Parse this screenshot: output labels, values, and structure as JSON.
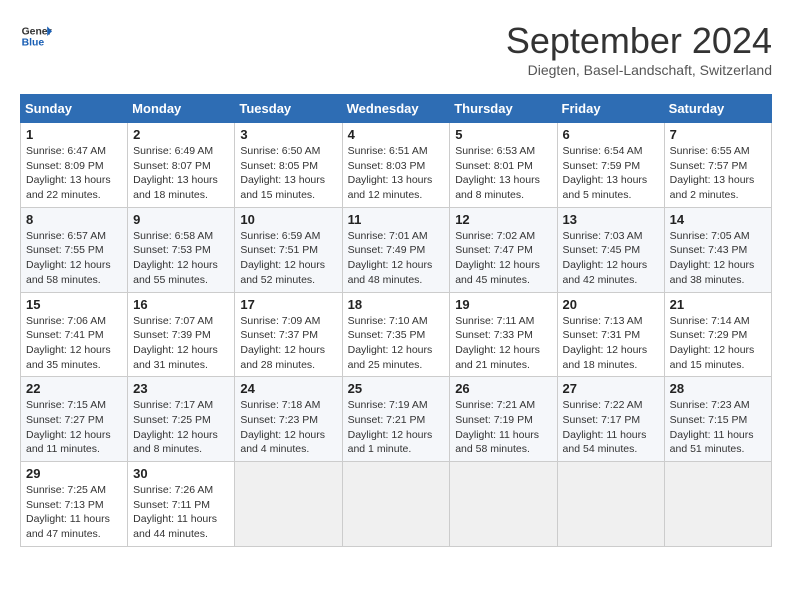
{
  "header": {
    "logo_line1": "General",
    "logo_line2": "Blue",
    "month": "September 2024",
    "location": "Diegten, Basel-Landschaft, Switzerland"
  },
  "weekdays": [
    "Sunday",
    "Monday",
    "Tuesday",
    "Wednesday",
    "Thursday",
    "Friday",
    "Saturday"
  ],
  "weeks": [
    [
      {
        "day": "1",
        "sunrise": "6:47 AM",
        "sunset": "8:09 PM",
        "daylight": "13 hours and 22 minutes."
      },
      {
        "day": "2",
        "sunrise": "6:49 AM",
        "sunset": "8:07 PM",
        "daylight": "13 hours and 18 minutes."
      },
      {
        "day": "3",
        "sunrise": "6:50 AM",
        "sunset": "8:05 PM",
        "daylight": "13 hours and 15 minutes."
      },
      {
        "day": "4",
        "sunrise": "6:51 AM",
        "sunset": "8:03 PM",
        "daylight": "13 hours and 12 minutes."
      },
      {
        "day": "5",
        "sunrise": "6:53 AM",
        "sunset": "8:01 PM",
        "daylight": "13 hours and 8 minutes."
      },
      {
        "day": "6",
        "sunrise": "6:54 AM",
        "sunset": "7:59 PM",
        "daylight": "13 hours and 5 minutes."
      },
      {
        "day": "7",
        "sunrise": "6:55 AM",
        "sunset": "7:57 PM",
        "daylight": "13 hours and 2 minutes."
      }
    ],
    [
      {
        "day": "8",
        "sunrise": "6:57 AM",
        "sunset": "7:55 PM",
        "daylight": "12 hours and 58 minutes."
      },
      {
        "day": "9",
        "sunrise": "6:58 AM",
        "sunset": "7:53 PM",
        "daylight": "12 hours and 55 minutes."
      },
      {
        "day": "10",
        "sunrise": "6:59 AM",
        "sunset": "7:51 PM",
        "daylight": "12 hours and 52 minutes."
      },
      {
        "day": "11",
        "sunrise": "7:01 AM",
        "sunset": "7:49 PM",
        "daylight": "12 hours and 48 minutes."
      },
      {
        "day": "12",
        "sunrise": "7:02 AM",
        "sunset": "7:47 PM",
        "daylight": "12 hours and 45 minutes."
      },
      {
        "day": "13",
        "sunrise": "7:03 AM",
        "sunset": "7:45 PM",
        "daylight": "12 hours and 42 minutes."
      },
      {
        "day": "14",
        "sunrise": "7:05 AM",
        "sunset": "7:43 PM",
        "daylight": "12 hours and 38 minutes."
      }
    ],
    [
      {
        "day": "15",
        "sunrise": "7:06 AM",
        "sunset": "7:41 PM",
        "daylight": "12 hours and 35 minutes."
      },
      {
        "day": "16",
        "sunrise": "7:07 AM",
        "sunset": "7:39 PM",
        "daylight": "12 hours and 31 minutes."
      },
      {
        "day": "17",
        "sunrise": "7:09 AM",
        "sunset": "7:37 PM",
        "daylight": "12 hours and 28 minutes."
      },
      {
        "day": "18",
        "sunrise": "7:10 AM",
        "sunset": "7:35 PM",
        "daylight": "12 hours and 25 minutes."
      },
      {
        "day": "19",
        "sunrise": "7:11 AM",
        "sunset": "7:33 PM",
        "daylight": "12 hours and 21 minutes."
      },
      {
        "day": "20",
        "sunrise": "7:13 AM",
        "sunset": "7:31 PM",
        "daylight": "12 hours and 18 minutes."
      },
      {
        "day": "21",
        "sunrise": "7:14 AM",
        "sunset": "7:29 PM",
        "daylight": "12 hours and 15 minutes."
      }
    ],
    [
      {
        "day": "22",
        "sunrise": "7:15 AM",
        "sunset": "7:27 PM",
        "daylight": "12 hours and 11 minutes."
      },
      {
        "day": "23",
        "sunrise": "7:17 AM",
        "sunset": "7:25 PM",
        "daylight": "12 hours and 8 minutes."
      },
      {
        "day": "24",
        "sunrise": "7:18 AM",
        "sunset": "7:23 PM",
        "daylight": "12 hours and 4 minutes."
      },
      {
        "day": "25",
        "sunrise": "7:19 AM",
        "sunset": "7:21 PM",
        "daylight": "12 hours and 1 minute."
      },
      {
        "day": "26",
        "sunrise": "7:21 AM",
        "sunset": "7:19 PM",
        "daylight": "11 hours and 58 minutes."
      },
      {
        "day": "27",
        "sunrise": "7:22 AM",
        "sunset": "7:17 PM",
        "daylight": "11 hours and 54 minutes."
      },
      {
        "day": "28",
        "sunrise": "7:23 AM",
        "sunset": "7:15 PM",
        "daylight": "11 hours and 51 minutes."
      }
    ],
    [
      {
        "day": "29",
        "sunrise": "7:25 AM",
        "sunset": "7:13 PM",
        "daylight": "11 hours and 47 minutes."
      },
      {
        "day": "30",
        "sunrise": "7:26 AM",
        "sunset": "7:11 PM",
        "daylight": "11 hours and 44 minutes."
      },
      null,
      null,
      null,
      null,
      null
    ]
  ]
}
